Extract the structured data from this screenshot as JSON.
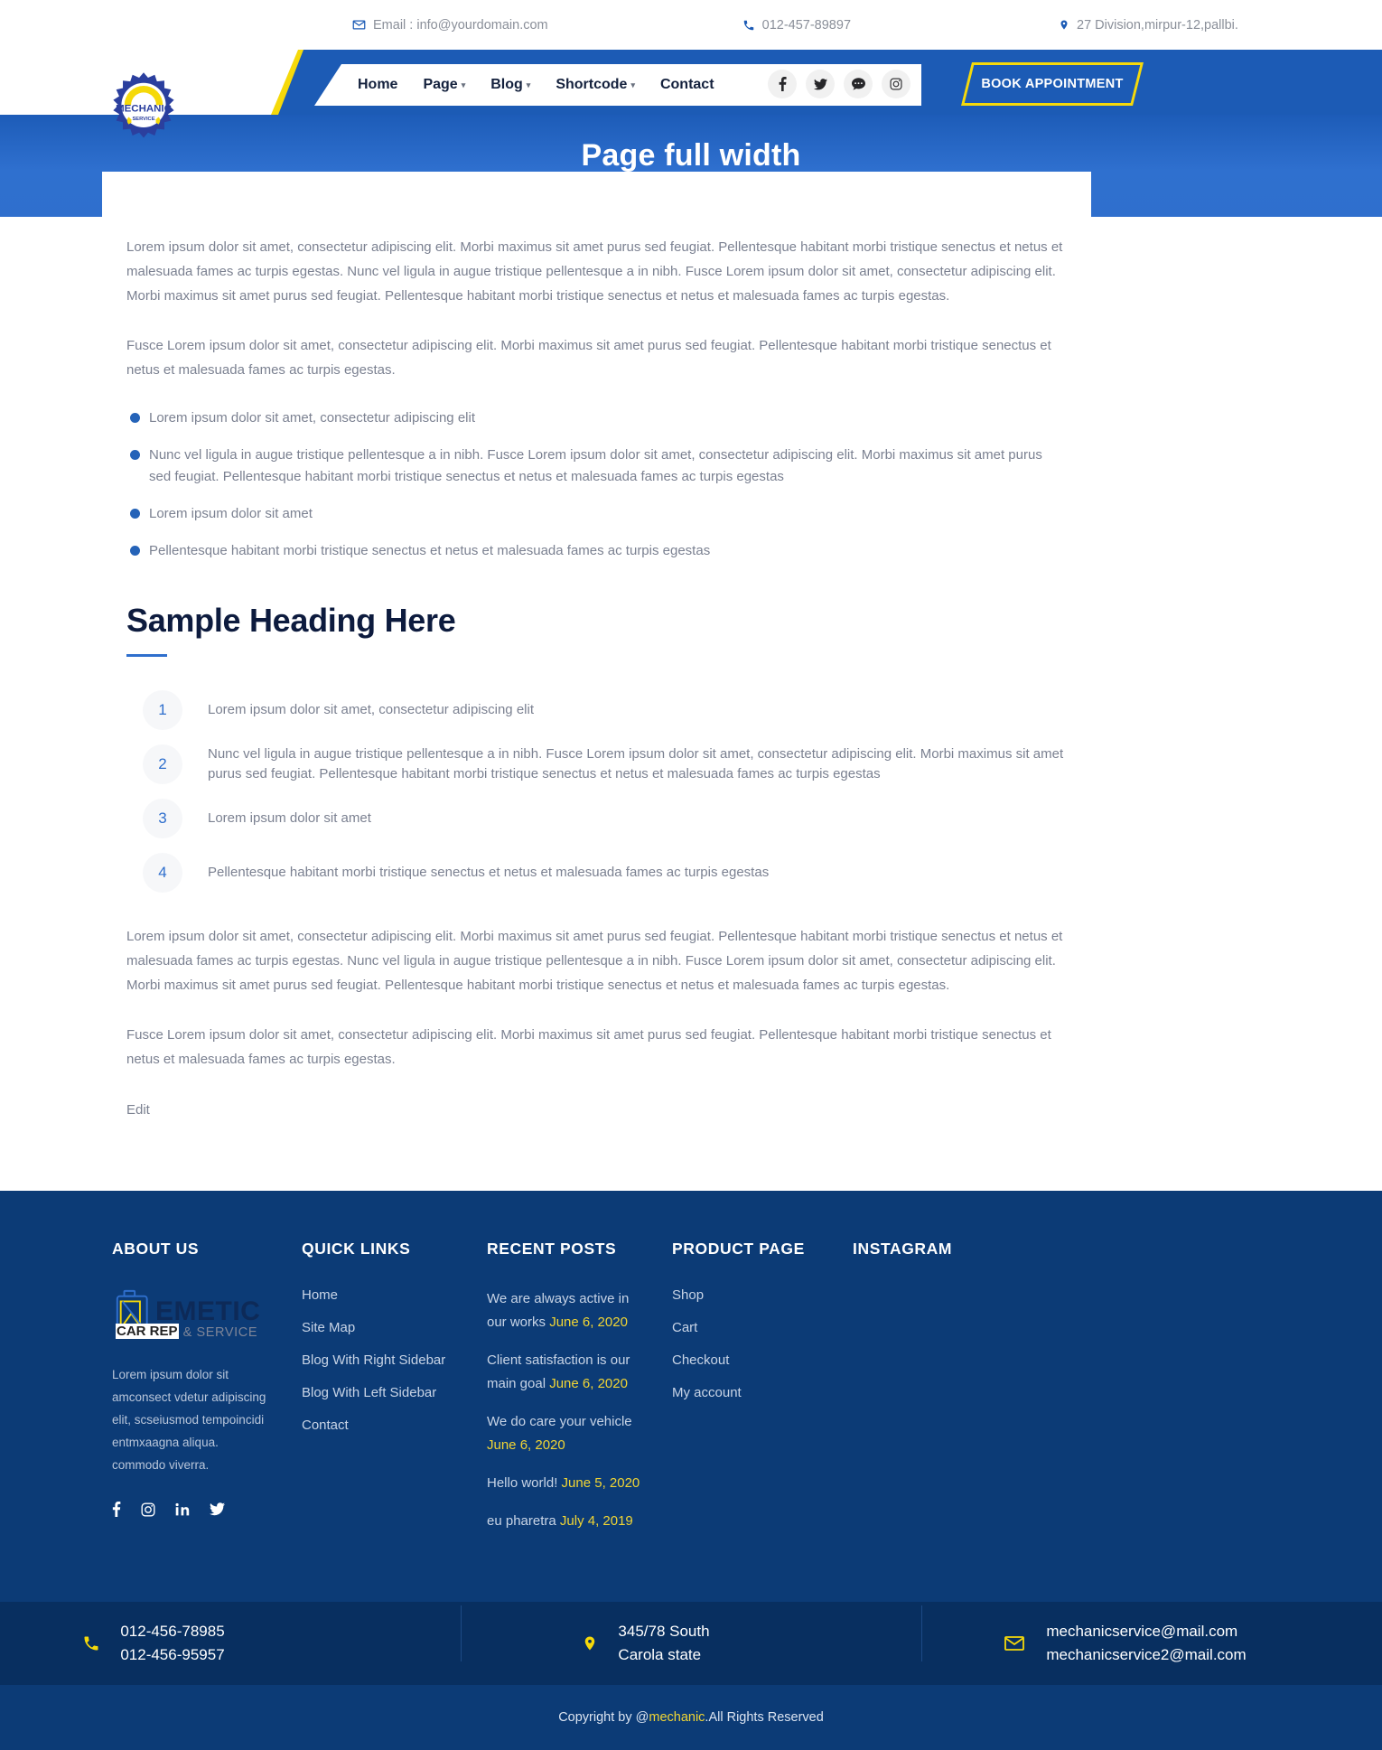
{
  "topbar": {
    "email": "Email : info@yourdomain.com",
    "phone": "012-457-89897",
    "address": "27 Division,mirpur-12,pallbi."
  },
  "nav": {
    "items": [
      {
        "label": "Home",
        "has_caret": false
      },
      {
        "label": "Page",
        "has_caret": true
      },
      {
        "label": "Blog",
        "has_caret": true
      },
      {
        "label": "Shortcode",
        "has_caret": true
      },
      {
        "label": "Contact",
        "has_caret": false
      }
    ],
    "social": [
      "facebook-icon",
      "twitter-icon",
      "comment-icon",
      "instagram-icon"
    ],
    "book_button": "BOOK APPOINTMENT"
  },
  "logo": {
    "name": "MECHANIC",
    "sub": "SERVICE"
  },
  "banner": {
    "title": "Page full width"
  },
  "content": {
    "paragraph_1": "Lorem ipsum dolor sit amet, consectetur adipiscing elit. Morbi maximus sit amet purus sed feugiat. Pellentesque habitant morbi tristique senectus et netus et malesuada fames ac turpis egestas. Nunc vel ligula in augue tristique pellentesque a in nibh. Fusce Lorem ipsum dolor sit amet, consectetur adipiscing elit. Morbi maximus sit amet purus sed feugiat. Pellentesque habitant morbi tristique senectus et netus et malesuada fames ac turpis egestas.",
    "paragraph_2": "Fusce Lorem ipsum dolor sit amet, consectetur adipiscing elit. Morbi maximus sit amet purus sed feugiat. Pellentesque habitant morbi tristique senectus et netus et malesuada fames ac turpis egestas.",
    "bullets": [
      "Lorem ipsum dolor sit amet, consectetur adipiscing elit",
      "Nunc vel ligula in augue tristique pellentesque a in nibh. Fusce Lorem ipsum dolor sit amet, consectetur adipiscing elit. Morbi maximus sit amet purus sed feugiat. Pellentesque habitant morbi tristique senectus et netus et malesuada fames ac turpis egestas",
      "Lorem ipsum dolor sit amet",
      "Pellentesque habitant morbi tristique senectus et netus et malesuada fames ac turpis egestas"
    ],
    "heading": "Sample Heading Here",
    "numbered": [
      {
        "num": "1",
        "text": "Lorem ipsum dolor sit amet, consectetur adipiscing elit"
      },
      {
        "num": "2",
        "text": "Nunc vel ligula in augue tristique pellentesque a in nibh. Fusce Lorem ipsum dolor sit amet, consectetur adipiscing elit. Morbi maximus sit amet purus sed feugiat. Pellentesque habitant morbi tristique senectus et netus et malesuada fames ac turpis egestas"
      },
      {
        "num": "3",
        "text": "Lorem ipsum dolor sit amet"
      },
      {
        "num": "4",
        "text": "Pellentesque habitant morbi tristique senectus et netus et malesuada fames ac turpis egestas"
      }
    ],
    "paragraph_3": "Lorem ipsum dolor sit amet, consectetur adipiscing elit. Morbi maximus sit amet purus sed feugiat. Pellentesque habitant morbi tristique senectus et netus et malesuada fames ac turpis egestas. Nunc vel ligula in augue tristique pellentesque a in nibh. Fusce Lorem ipsum dolor sit amet, consectetur adipiscing elit. Morbi maximus sit amet purus sed feugiat. Pellentesque habitant morbi tristique senectus et netus et malesuada fames ac turpis egestas.",
    "paragraph_4": "Fusce Lorem ipsum dolor sit amet, consectetur adipiscing elit. Morbi maximus sit amet purus sed feugiat. Pellentesque habitant morbi tristique senectus et netus et malesuada fames ac turpis egestas.",
    "edit_link": "Edit"
  },
  "footer": {
    "about": {
      "title": "ABOUT US",
      "logo_main": "EMETIC",
      "logo_sub": "AIR & SERVICE",
      "logo_overlay": "CAR REP",
      "text": "Lorem ipsum dolor sit amconsect vdetur adipiscing elit, scseiusmod tempoincidi entmxaagna aliqua. commodo viverra.",
      "social": [
        "facebook-icon",
        "instagram-icon",
        "linkedin-icon",
        "twitter-icon"
      ]
    },
    "quick_links": {
      "title": "QUICK LINKS",
      "items": [
        "Home",
        "Site Map",
        "Blog With Right Sidebar",
        "Blog With Left Sidebar",
        "Contact"
      ]
    },
    "recent_posts": {
      "title": "RECENT POSTS",
      "items": [
        {
          "text": "We are always active in our works ",
          "date": "June 6, 2020"
        },
        {
          "text": "Client satisfaction is our main goal ",
          "date": "June 6, 2020"
        },
        {
          "text": "We do care your vehicle ",
          "date": "June 6, 2020"
        },
        {
          "text": "Hello world! ",
          "date": "June 5, 2020"
        },
        {
          "text": "eu pharetra ",
          "date": "July 4, 2019"
        }
      ]
    },
    "product_page": {
      "title": "PRODUCT PAGE",
      "items": [
        "Shop",
        "Cart",
        "Checkout",
        "My account"
      ]
    },
    "instagram": {
      "title": "INSTAGRAM"
    }
  },
  "contact_strip": {
    "phone_1": "012-456-78985",
    "phone_2": "012-456-95957",
    "address_1": "345/78 South",
    "address_2": "Carola state",
    "email_1": "mechanicservice@mail.com",
    "email_2": "mechanicservice2@mail.com"
  },
  "copyright": {
    "pre": "Copyright by @",
    "brand": "mechanic",
    "post": ".All Rights Reserved"
  }
}
